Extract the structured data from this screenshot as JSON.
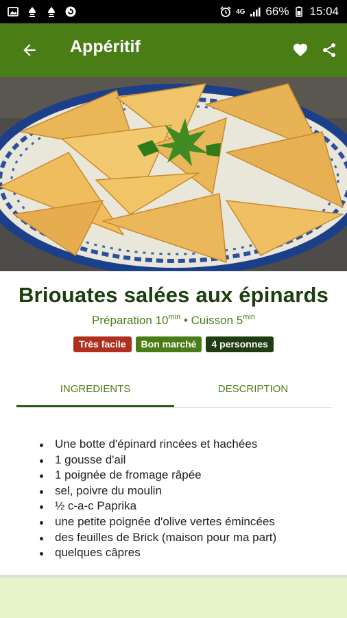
{
  "status_bar": {
    "battery_percent": "66%",
    "time": "15:04",
    "network": "4G",
    "icons_left": [
      "gallery-icon",
      "notification-icon",
      "notification-icon",
      "sync-icon"
    ],
    "icons_right": [
      "alarm-icon",
      "network-4g-icon",
      "signal-icon",
      "battery-icon"
    ]
  },
  "app_bar": {
    "title": "Appéritif",
    "back_icon": "arrow-back-icon",
    "favorite_icon": "heart-icon",
    "share_icon": "share-icon"
  },
  "recipe": {
    "title": "Briouates salées aux épinards",
    "prep_label": "Préparation 10",
    "prep_unit": "min",
    "separator": " • ",
    "cook_label": "Cuisson 5",
    "cook_unit": "min",
    "badges": {
      "difficulty": "Très facile",
      "cost": "Bon marché",
      "servings": "4 personnes"
    }
  },
  "tabs": {
    "ingredients": "INGREDIENTS",
    "description": "DESCRIPTION",
    "active": "ingredients"
  },
  "ingredients": [
    "Une botte d'épinard rincées et hachées",
    "1 gousse d'ail",
    "1 poignée de fromage râpée",
    "sel, poivre du moulin",
    "½ c-a-c Paprika",
    "une petite poignée d'olive vertes émincées",
    "des feuilles de Brick (maison pour ma part)",
    "quelques câpres"
  ],
  "colors": {
    "app_bar": "#4a7d16",
    "title_text": "#1e3d0e",
    "badge_red": "#b0301f",
    "badge_green": "#4a7d16",
    "badge_dark": "#1f3d10",
    "bottom_panel": "#e6f5c9"
  }
}
